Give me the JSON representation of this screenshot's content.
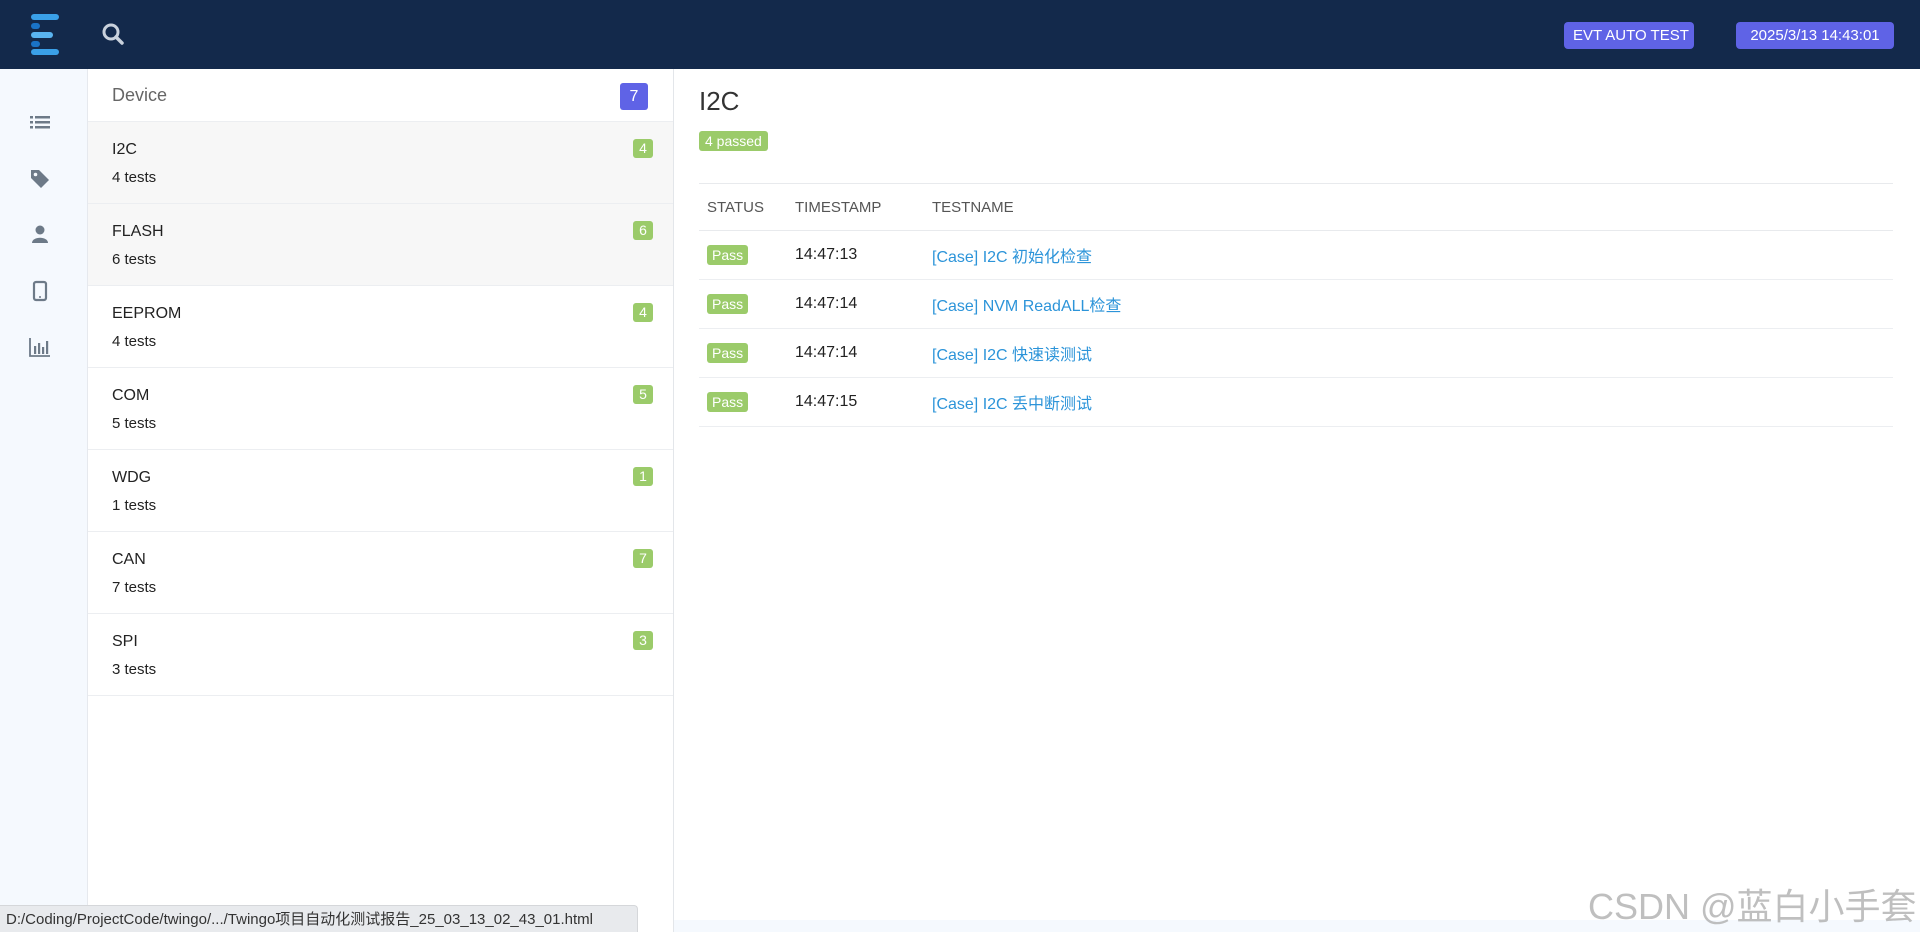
{
  "topnav": {
    "report_title": "EVT AUTO TEST",
    "timestamp": "2025/3/13 14:43:01"
  },
  "sidebar": {
    "icons": [
      "list-icon",
      "tag-icon",
      "user-icon",
      "tablet-icon",
      "bar-chart-icon"
    ]
  },
  "categories": {
    "header": "Device",
    "header_count": "7",
    "items": [
      {
        "name": "I2C",
        "tests": "4 tests",
        "count": "4"
      },
      {
        "name": "FLASH",
        "tests": "6 tests",
        "count": "6"
      },
      {
        "name": "EEPROM",
        "tests": "4 tests",
        "count": "4"
      },
      {
        "name": "COM",
        "tests": "5 tests",
        "count": "5"
      },
      {
        "name": "WDG",
        "tests": "1 tests",
        "count": "1"
      },
      {
        "name": "CAN",
        "tests": "7 tests",
        "count": "7"
      },
      {
        "name": "SPI",
        "tests": "3 tests",
        "count": "3"
      }
    ]
  },
  "detail": {
    "title": "I2C",
    "passed_label": "4 passed",
    "columns": [
      "STATUS",
      "TIMESTAMP",
      "TESTNAME"
    ],
    "rows": [
      {
        "status": "Pass",
        "timestamp": "14:47:13",
        "testname": "[Case] I2C 初始化检查"
      },
      {
        "status": "Pass",
        "timestamp": "14:47:14",
        "testname": "[Case] NVM ReadALL检查"
      },
      {
        "status": "Pass",
        "timestamp": "14:47:14",
        "testname": "[Case] I2C 快速读测试"
      },
      {
        "status": "Pass",
        "timestamp": "14:47:15",
        "testname": "[Case] I2C 丢中断测试"
      }
    ]
  },
  "statusbar": {
    "url": "D:/Coding/ProjectCode/twingo/.../Twingo项目自动化测试报告_25_03_13_02_43_01.html"
  },
  "watermark": "CSDN @蓝白小手套",
  "colors": {
    "nav_bg": "#13294b",
    "accent": "#5f63e6",
    "pass": "#9bcb6a",
    "link": "#2c94d9"
  }
}
